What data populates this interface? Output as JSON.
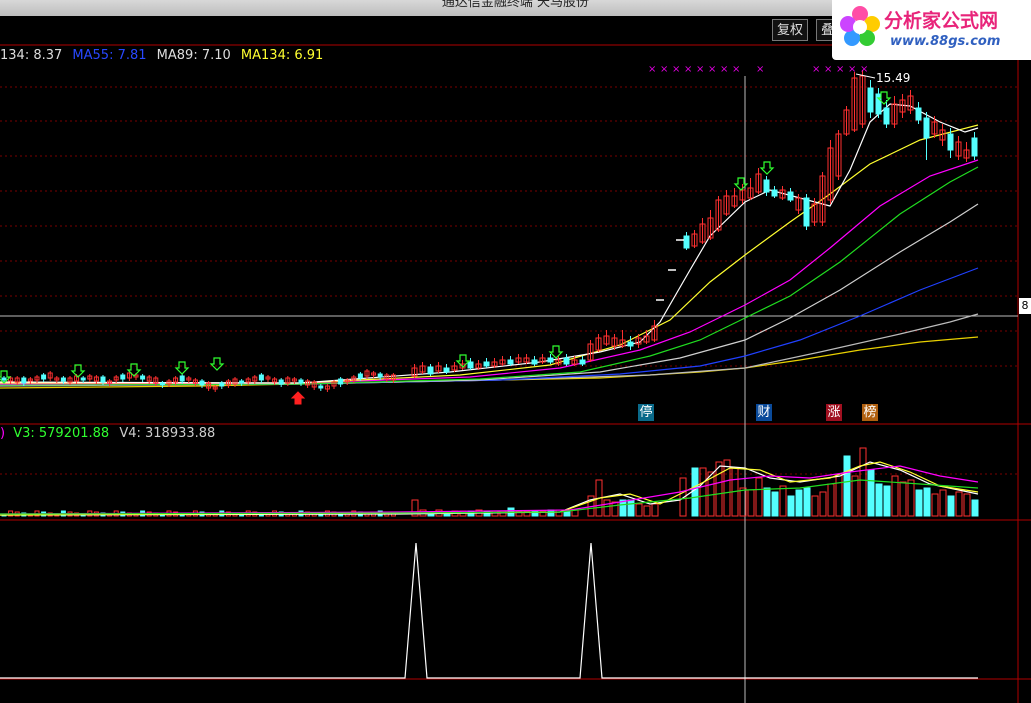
{
  "window": {
    "title": "通达信金融终端   天马股份"
  },
  "toolbar": {
    "restore_rights_label": "复权",
    "overlay_label": "叠"
  },
  "logo": {
    "title": "分析家公式网",
    "url_text": "www.88gs.com"
  },
  "ma_legend": {
    "ma34": "134: 8.37",
    "ma55": "MA55: 7.81",
    "ma89": "MA89: 7.10",
    "ma134": "MA134: 6.91"
  },
  "volume_legend": {
    "prefix": ")",
    "v3": "V3: 579201.88",
    "v4": "V4: 318933.88"
  },
  "price_tag": "8",
  "peak_label": "15.49",
  "event_tags": {
    "stop": "停",
    "finance": "财",
    "limit_up": "涨",
    "list": "榜"
  },
  "colors": {
    "up": "#ff3030",
    "down": "#54ffff",
    "ma_white": "#ffffff",
    "ma_yellow": "#ffff00",
    "ma_magenta": "#ff00ff",
    "ma_green": "#00ff00",
    "ma_gray": "#c0c0c0",
    "ma_blue": "#2040ff",
    "grid": "#8b0000"
  }
}
